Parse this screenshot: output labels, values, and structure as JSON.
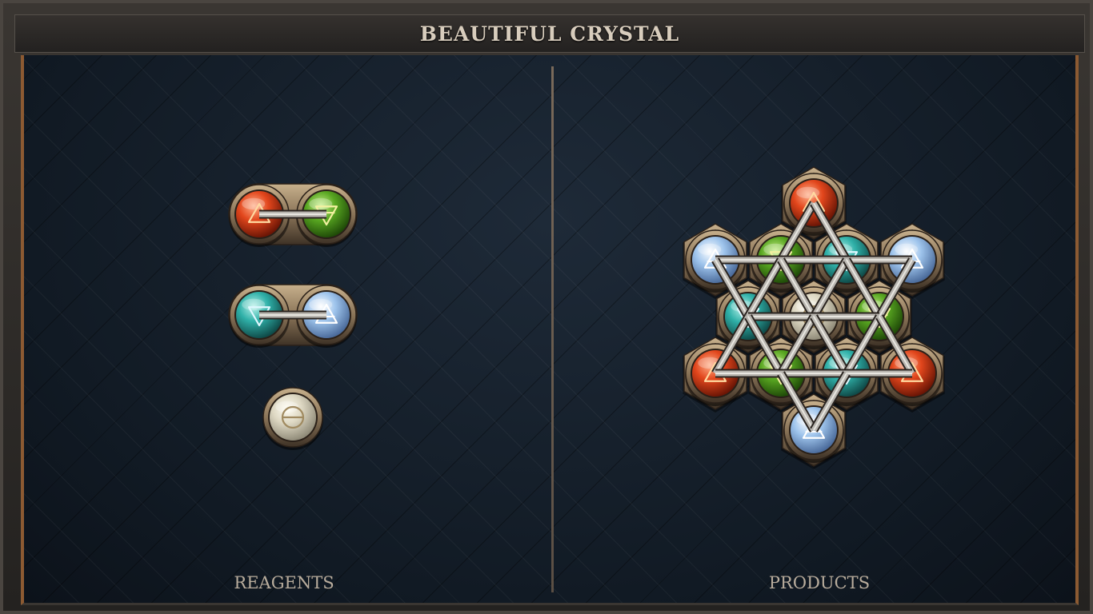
{
  "title": "BEAUTIFUL CRYSTAL",
  "panels": {
    "reagents_label": "REAGENTS",
    "products_label": "PRODUCTS"
  },
  "colors": {
    "fire": "#e2461c",
    "earth": "#58a621",
    "water": "#2fb0a8",
    "air": "#9ec4ec",
    "salt": "#ddd7c2",
    "frame_bronze": "#8a7458"
  },
  "reagents": [
    {
      "name": "reagent-pair-fire-earth",
      "atoms": [
        "fire",
        "earth"
      ]
    },
    {
      "name": "reagent-pair-water-air",
      "atoms": [
        "water",
        "air"
      ]
    },
    {
      "name": "reagent-salt",
      "atoms": [
        "salt"
      ]
    }
  ],
  "product": {
    "atoms": [
      "fire",
      "air",
      "earth",
      "water",
      "air",
      "water",
      "salt",
      "earth",
      "fire",
      "earth",
      "water",
      "fire",
      "air"
    ]
  }
}
